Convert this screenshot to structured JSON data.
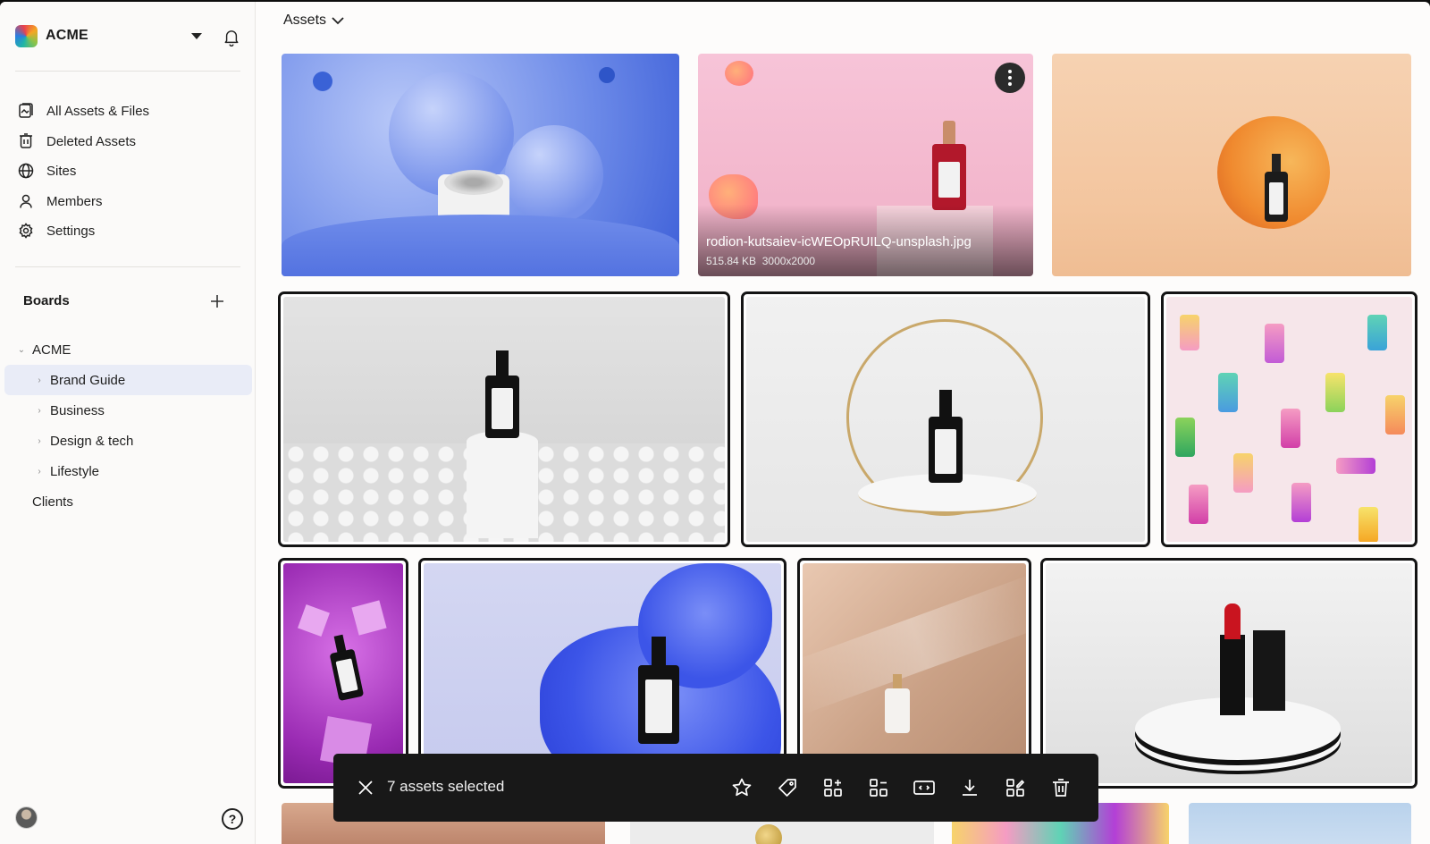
{
  "sidebar": {
    "workspace": "ACME",
    "nav": [
      {
        "label": "All Assets & Files",
        "icon": "assets-icon"
      },
      {
        "label": "Deleted Assets",
        "icon": "trash-icon"
      },
      {
        "label": "Sites",
        "icon": "globe-icon"
      },
      {
        "label": "Members",
        "icon": "user-icon"
      },
      {
        "label": "Settings",
        "icon": "gear-icon"
      }
    ],
    "boards_title": "Boards",
    "tree": [
      {
        "label": "ACME",
        "expanded": true
      },
      {
        "label": "Brand Guide",
        "active": true
      },
      {
        "label": "Business"
      },
      {
        "label": "Design & tech"
      },
      {
        "label": "Lifestyle"
      },
      {
        "label": "Clients"
      }
    ],
    "help": "?"
  },
  "header": {
    "breadcrumb": "Assets"
  },
  "hovered_asset": {
    "name": "rodion-kutsaiev-icWEOpRUILQ-unsplash.jpg",
    "size": "515.84 KB",
    "dimensions": "3000x2000"
  },
  "selection_bar": {
    "count_text": "7 assets selected",
    "actions": [
      "star-icon",
      "tag-icon",
      "add-to-board-icon",
      "move-icon",
      "resize-icon",
      "download-icon",
      "edit-icon",
      "delete-icon"
    ]
  },
  "colors": {
    "selection_border": "#141414",
    "active_board": "#e9ecf7",
    "bar_bg": "#181818"
  }
}
